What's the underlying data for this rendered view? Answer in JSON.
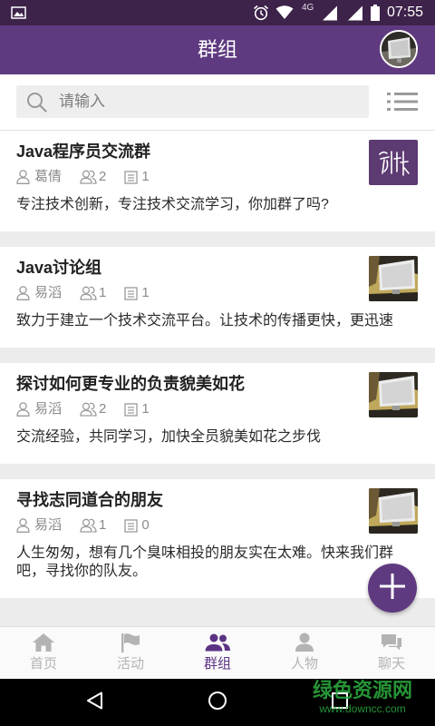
{
  "status_bar": {
    "network": "4G",
    "time": "07:55",
    "icons": [
      "gallery-icon",
      "alarm-icon",
      "wifi-icon",
      "signal-icon",
      "signal-icon",
      "battery-icon"
    ]
  },
  "header": {
    "title": "群组",
    "avatar_icon": "avatar"
  },
  "search": {
    "placeholder": "请输入",
    "icon": "search-icon",
    "view_toggle_icon": "list-icon"
  },
  "groups": [
    {
      "title": "Java程序员交流群",
      "owner": "葛倩",
      "members": "2",
      "posts": "1",
      "description": "专注技术创新，专注技术交流学习，你加群了吗?"
    },
    {
      "title": "Java讨论组",
      "owner": "易滔",
      "members": "1",
      "posts": "1",
      "description": "致力于建立一个技术交流平台。让技术的传播更快，更迅速"
    },
    {
      "title": "探讨如何更专业的负责貌美如花",
      "owner": "易滔",
      "members": "2",
      "posts": "1",
      "description": "交流经验，共同学习，加快全员貌美如花之步伐"
    },
    {
      "title": "寻找志同道合的朋友",
      "owner": "易滔",
      "members": "1",
      "posts": "0",
      "description": "人生匆匆，想有几个臭味相投的朋友实在太难。快来我们群吧，寻找你的队友。"
    }
  ],
  "meta_icons": [
    "person-icon",
    "members-icon",
    "posts-icon"
  ],
  "fab": {
    "icon": "plus-icon"
  },
  "bottom_nav": {
    "active_index": 2,
    "items": [
      {
        "label": "首页",
        "icon": "home-icon"
      },
      {
        "label": "活动",
        "icon": "flag-icon"
      },
      {
        "label": "群组",
        "icon": "group-icon"
      },
      {
        "label": "人物",
        "icon": "person-icon"
      },
      {
        "label": "聊天",
        "icon": "chat-icon"
      }
    ]
  },
  "system_nav": {
    "icons": [
      "back-icon",
      "home-circle-icon",
      "recents-icon"
    ]
  },
  "watermark": {
    "line1": "绿色资源网",
    "line2": "www.downcc.com"
  },
  "colors": {
    "primary": "#5f3a80",
    "status_bar": "#3d2249",
    "active_tab": "#5b3384",
    "inactive_tab": "#b3b3b3",
    "watermark": "#2aa53c"
  }
}
